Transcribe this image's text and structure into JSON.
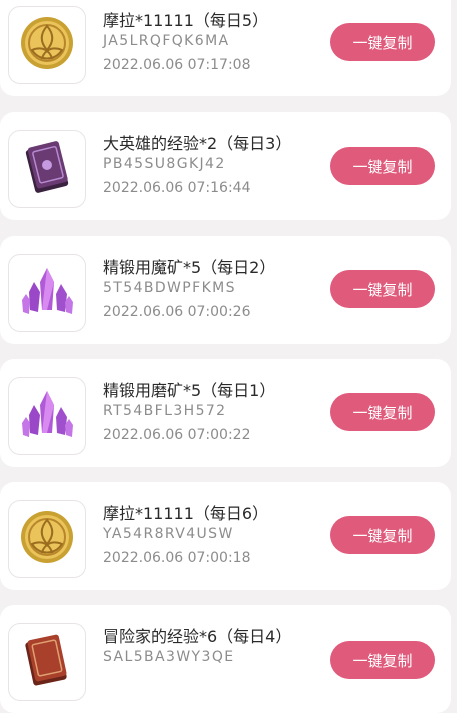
{
  "items": [
    {
      "name": "摩拉*11111（每日5）",
      "code": "JA5LRQFQK6MA",
      "time": "2022.06.06 07:17:08",
      "icon": "mora-coin-icon",
      "button": "一键复制"
    },
    {
      "name": "大英雄的经验*2（每日3）",
      "code": "PB45SU8GKJ42",
      "time": "2022.06.06 07:16:44",
      "icon": "heros-wit-book-icon",
      "button": "一键复制"
    },
    {
      "name": "精锻用魔矿*5（每日2）",
      "code": "5T54BDWPFKMS",
      "time": "2022.06.06 07:00:26",
      "icon": "mystic-ore-crystal-icon",
      "button": "一键复制"
    },
    {
      "name": "精锻用磨矿*5（每日1）",
      "code": "RT54BFL3H572",
      "time": "2022.06.06 07:00:22",
      "icon": "mystic-ore-crystal-icon",
      "button": "一键复制"
    },
    {
      "name": "摩拉*11111（每日6）",
      "code": "YA54R8RV4USW",
      "time": "2022.06.06 07:00:18",
      "icon": "mora-coin-icon",
      "button": "一键复制"
    },
    {
      "name": "冒险家的经验*6（每日4）",
      "code": "SAL5BA3WY3QE",
      "time": "",
      "icon": "adventurers-experience-book-icon",
      "button": "一键复制"
    }
  ],
  "colors": {
    "button": "#e05a7b",
    "background": "#f3f1f2"
  }
}
